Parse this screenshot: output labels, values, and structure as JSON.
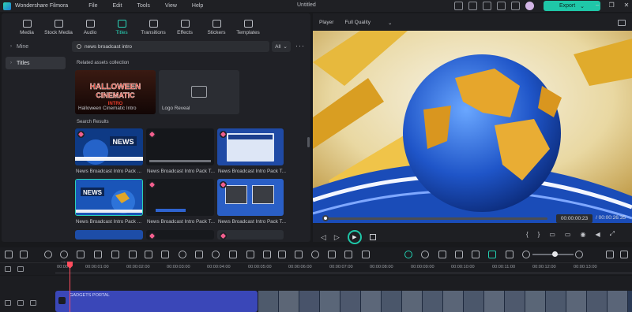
{
  "titlebar": {
    "app_name": "Wondershare Filmora",
    "menu": [
      "File",
      "Edit",
      "Tools",
      "View",
      "Help"
    ],
    "doc_title": "Untitled",
    "export_label": "Export"
  },
  "tabs": [
    {
      "label": "Media",
      "icon": "media-icon"
    },
    {
      "label": "Stock Media",
      "icon": "stock-media-icon"
    },
    {
      "label": "Audio",
      "icon": "music-note-icon"
    },
    {
      "label": "Titles",
      "icon": "text-t-icon",
      "active": true
    },
    {
      "label": "Transitions",
      "icon": "transitions-icon"
    },
    {
      "label": "Effects",
      "icon": "effects-sparkle-icon"
    },
    {
      "label": "Stickers",
      "icon": "stickers-icon"
    },
    {
      "label": "Templates",
      "icon": "templates-icon"
    }
  ],
  "sidebar": {
    "items": [
      {
        "label": "Mine"
      },
      {
        "label": "Titles"
      }
    ]
  },
  "search": {
    "value": "news broadcast intro",
    "filter": "All"
  },
  "related": {
    "heading": "Related assets collection",
    "items": [
      {
        "label": "Halloween Cinematic Intro",
        "thumb_text": "HALLOWEEN CINEMATIC INTRO"
      },
      {
        "label": "Logo Reveal"
      }
    ]
  },
  "results": {
    "heading": "Search Results",
    "items": [
      {
        "label": "News Broadcast Intro Pack ...",
        "thumb_text": "NEWS"
      },
      {
        "label": "News Broadcast Intro Pack T..."
      },
      {
        "label": "News Broadcast Intro Pack T..."
      },
      {
        "label": "News Broadcast Intro Pack ...",
        "thumb_text": "NEWS"
      },
      {
        "label": "News Broadcast Intro Pack T..."
      },
      {
        "label": "News Broadcast Intro Pack T..."
      }
    ]
  },
  "player": {
    "label": "Player",
    "quality": "Full Quality",
    "current_time": "00:00:00:23",
    "total_time": "/ 00:00:26:35",
    "progress": 0.01
  },
  "ruler": {
    "labels": [
      "00:00",
      "00:00:01:00",
      "00:00:02:00",
      "00:00:03:00",
      "00:00:04:00",
      "00:00:05:00",
      "00:00:06:00",
      "00:00:07:00",
      "00:00:08:00",
      "00:00:09:00",
      "00:00:10:00",
      "00:00:11:00",
      "00:00:12:00",
      "00:00:13:00"
    ]
  },
  "timeline": {
    "title_clip_label": "GADGETS PORTAL"
  },
  "colors": {
    "accent": "#1fc7a8",
    "playhead": "#ff4d5e",
    "title_clip": "#3a47b8"
  }
}
